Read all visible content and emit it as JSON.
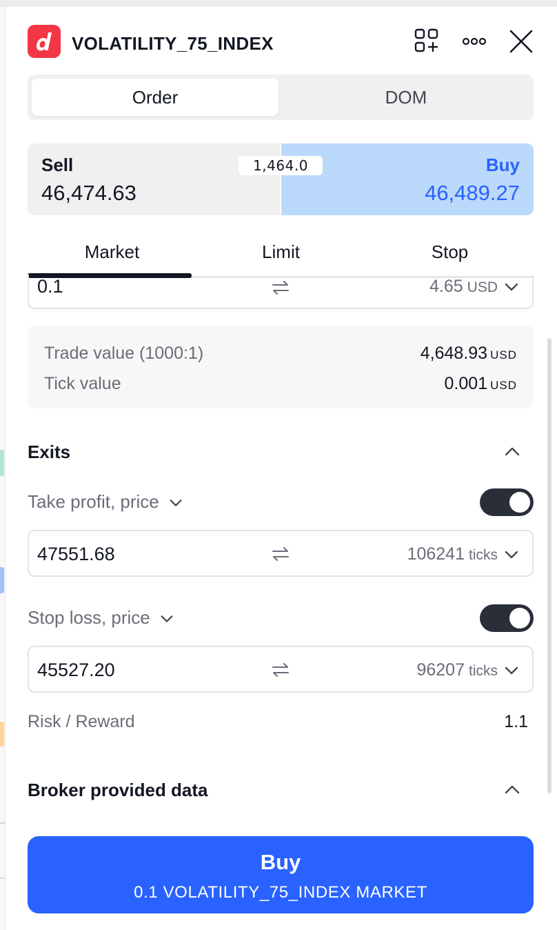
{
  "header": {
    "symbol": "VOLATILITY_75_INDEX",
    "logo_icon": "broker-logo-d",
    "icons": [
      "add-layout-icon",
      "more-icon",
      "close-icon"
    ]
  },
  "mode_tabs": [
    {
      "label": "Order",
      "active": true
    },
    {
      "label": "DOM",
      "active": false
    }
  ],
  "quote": {
    "sell_label": "Sell",
    "sell_price": "46,474.63",
    "buy_label": "Buy",
    "buy_price": "46,489.27",
    "spread": "1,464.0"
  },
  "order_types": [
    {
      "label": "Market",
      "active": true
    },
    {
      "label": "Limit",
      "active": false
    },
    {
      "label": "Stop",
      "active": false
    }
  ],
  "quantity": {
    "value": "0.1",
    "amount": "4.65",
    "unit": "USD"
  },
  "trade_info": {
    "trade_value_label": "Trade value (1000:1)",
    "trade_value": "4,648.93",
    "trade_value_unit": "USD",
    "tick_value_label": "Tick value",
    "tick_value": "0.001",
    "tick_value_unit": "USD"
  },
  "exits": {
    "title": "Exits",
    "take_profit": {
      "label": "Take profit, price",
      "enabled": true,
      "value": "47551.68",
      "ticks": "106241",
      "ticks_unit": "ticks"
    },
    "stop_loss": {
      "label": "Stop loss, price",
      "enabled": true,
      "value": "45527.20",
      "ticks": "96207",
      "ticks_unit": "ticks"
    },
    "risk_reward_label": "Risk / Reward",
    "risk_reward_value": "1.1"
  },
  "broker": {
    "title": "Broker provided data"
  },
  "submit": {
    "label": "Buy",
    "detail": "0.1 VOLATILITY_75_INDEX MARKET"
  },
  "colors": {
    "accent": "#2962ff",
    "buy_bg": "#bbd9fb",
    "buy_text": "#2962ff",
    "logo": "#f23645"
  }
}
